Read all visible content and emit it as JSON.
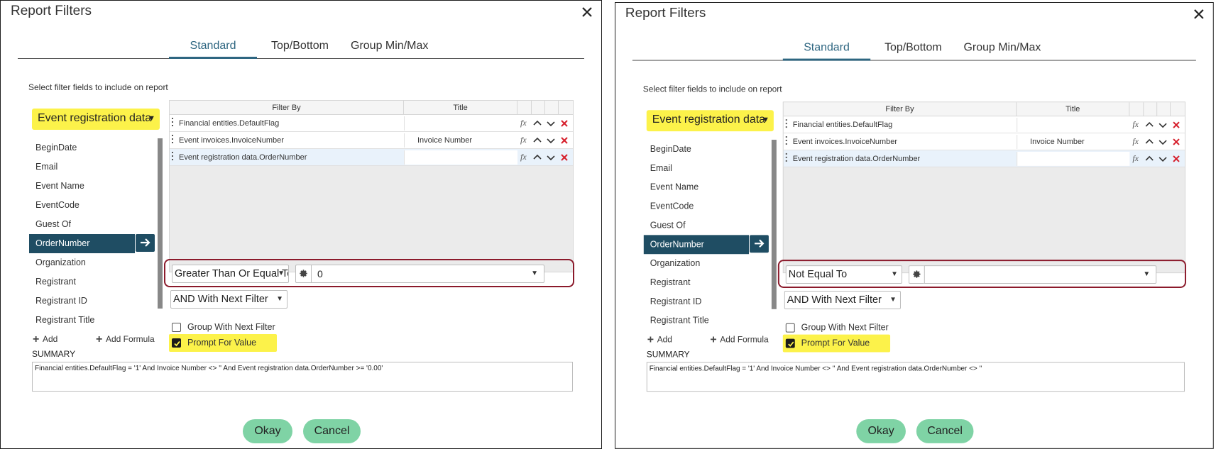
{
  "dialogs": [
    {
      "title": "Report Filters",
      "tabs": [
        "Standard",
        "Top/Bottom",
        "Group Min/Max"
      ],
      "active_tab": "Standard",
      "instructions": "Select filter fields to include on report",
      "source": "Event registration data",
      "fields": [
        "BeginDate",
        "Email",
        "Event Name",
        "EventCode",
        "Guest Of",
        "OrderNumber",
        "Organization",
        "Registrant",
        "Registrant ID",
        "Registrant Title"
      ],
      "selected_field": "OrderNumber",
      "grid": {
        "headers": {
          "filter_by": "Filter By",
          "title": "Title"
        },
        "rows": [
          {
            "filter_by": "Financial entities.DefaultFlag",
            "title": ""
          },
          {
            "filter_by": "Event invoices.InvoiceNumber",
            "title": "Invoice Number"
          },
          {
            "filter_by": "Event registration data.OrderNumber",
            "title": ""
          }
        ]
      },
      "operator": "Greater Than Or Equal To",
      "value": "0",
      "join": "AND With Next Filter",
      "group_with_next": {
        "label": "Group With Next Filter",
        "checked": false
      },
      "prompt_for_value": {
        "label": "Prompt For Value",
        "checked": true
      },
      "add_label": "Add",
      "add_formula_label": "Add Formula",
      "summary_label": "SUMMARY",
      "summary": "Financial entities.DefaultFlag = '1' And Invoice Number <> '' And Event registration data.OrderNumber >= '0.00'",
      "okay_label": "Okay",
      "cancel_label": "Cancel"
    },
    {
      "title": "Report Filters",
      "tabs": [
        "Standard",
        "Top/Bottom",
        "Group Min/Max"
      ],
      "active_tab": "Standard",
      "instructions": "Select filter fields to include on report",
      "source": "Event registration data",
      "fields": [
        "BeginDate",
        "Email",
        "Event Name",
        "EventCode",
        "Guest Of",
        "OrderNumber",
        "Organization",
        "Registrant",
        "Registrant ID",
        "Registrant Title"
      ],
      "selected_field": "OrderNumber",
      "grid": {
        "headers": {
          "filter_by": "Filter By",
          "title": "Title"
        },
        "rows": [
          {
            "filter_by": "Financial entities.DefaultFlag",
            "title": ""
          },
          {
            "filter_by": "Event invoices.InvoiceNumber",
            "title": "Invoice Number"
          },
          {
            "filter_by": "Event registration data.OrderNumber",
            "title": ""
          }
        ]
      },
      "operator": "Not Equal To",
      "value": "",
      "join": "AND With Next Filter",
      "group_with_next": {
        "label": "Group With Next Filter",
        "checked": false
      },
      "prompt_for_value": {
        "label": "Prompt For Value",
        "checked": true
      },
      "add_label": "Add",
      "add_formula_label": "Add Formula",
      "summary_label": "SUMMARY",
      "summary": "Financial entities.DefaultFlag = '1' And Invoice Number <> '' And Event registration data.OrderNumber <> ''",
      "okay_label": "Okay",
      "cancel_label": "Cancel"
    }
  ],
  "colors": {
    "highlight": "#fcf24a",
    "selected_field": "#1f4d63",
    "active_tab": "#2e6681",
    "operator_box_border": "#8b1a2b",
    "button": "#7fd3a5",
    "remove_icon": "#d61f2c"
  },
  "icons": [
    "close-icon",
    "arrow-right-icon",
    "fx-icon",
    "chevron-up-icon",
    "chevron-down-icon",
    "remove-x-icon",
    "gear-icon",
    "plus-icon",
    "checkbox-check-icon"
  ]
}
